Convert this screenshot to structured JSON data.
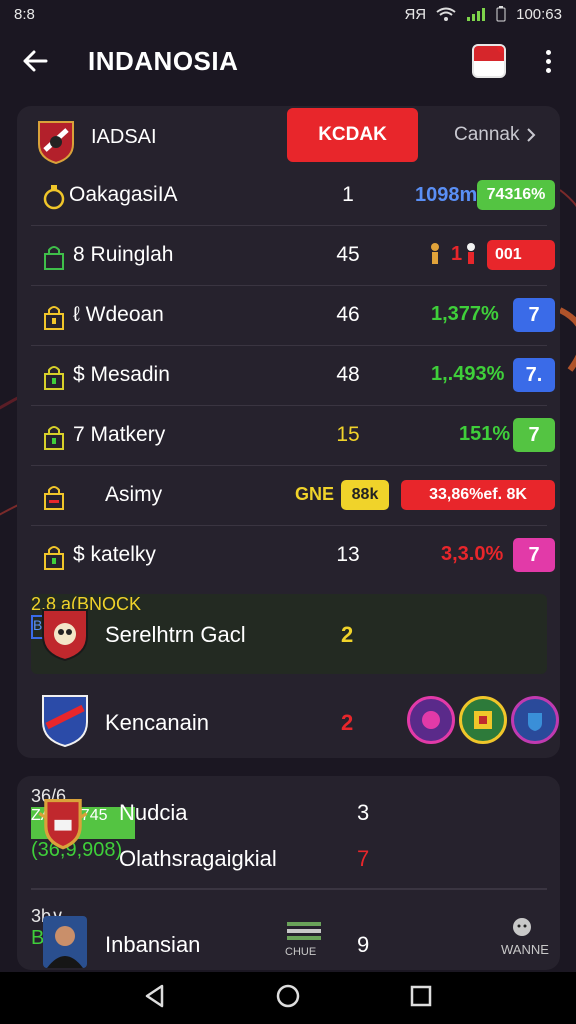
{
  "status": {
    "left": "8:8",
    "right_icons": "ЯЯ",
    "time": "100:63"
  },
  "appbar": {
    "title": "INDANOSIA"
  },
  "card": {
    "team_name": "IADSAI",
    "primary_button": "KCDAK",
    "link": "Cannak",
    "rows": [
      {
        "label": "OakagasiIA",
        "value": "1",
        "pct": "1098m",
        "badge": "74316%"
      },
      {
        "label": "Ruinglah",
        "prefix": "8",
        "value": "45",
        "pct": "1",
        "badge": "001"
      },
      {
        "label": "Wdeoan",
        "prefix": "ℓ",
        "value": "46",
        "pct": "1,377%",
        "badge": "7"
      },
      {
        "label": "Mesadin",
        "prefix": "$",
        "value": "48",
        "pct": "1,.493%",
        "badge": "7."
      },
      {
        "label": "Matkery",
        "prefix": "7",
        "value": "15",
        "pct": "151%",
        "badge": "7"
      },
      {
        "label": "Asimy",
        "value_text": "GNE",
        "value_badge": "88k",
        "wide_badge": "33,86%ef. 8K"
      },
      {
        "label": "katelky",
        "prefix": "$",
        "value": "13",
        "pct": "3,3.0%",
        "badge": "7"
      }
    ],
    "featured": [
      {
        "label": "Serelhtrn Gacl",
        "value": "2",
        "pct": "2.8 a(BNOCK",
        "badge": "B0"
      },
      {
        "label": "Kencanain",
        "value": "2"
      }
    ]
  },
  "card2": {
    "rows": [
      {
        "label": "Nudcia",
        "value": "3",
        "pct": "36/6",
        "badge": "ZAN02745"
      },
      {
        "label": "Olathsragaigkial",
        "value": "7",
        "pct": "(36,9,908)"
      },
      {
        "label": "Inbansian",
        "chart_caption": "CHUE",
        "value": "9",
        "pct": "3b∨",
        "icon_letter": "B",
        "right_label": "WANNE"
      }
    ]
  },
  "colors": {
    "accent_red": "#e8262b",
    "green": "#54c442",
    "blue": "#3a6be8",
    "yellow": "#f0d32a",
    "magenta": "#e23aa8",
    "card_bg": "#26222d"
  }
}
